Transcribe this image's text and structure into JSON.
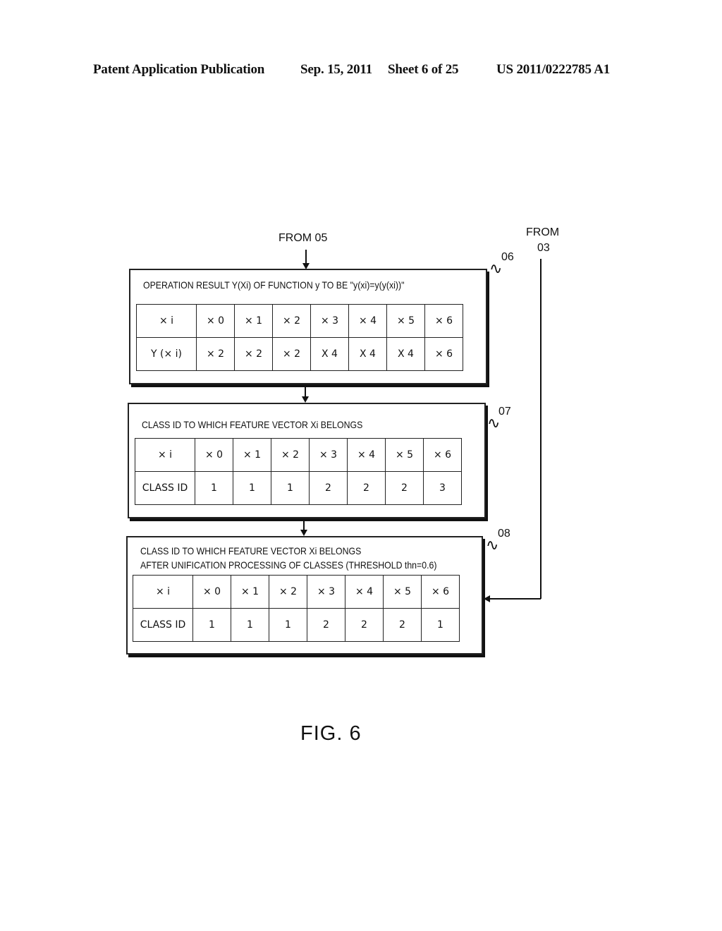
{
  "header": {
    "publication": "Patent Application Publication",
    "date": "Sep. 15, 2011",
    "sheet": "Sheet 6 of 25",
    "number": "US 2011/0222785 A1"
  },
  "connectors": {
    "from_top": "FROM 05",
    "from_right_line1": "FROM",
    "from_right_line2": "03"
  },
  "blocks": [
    {
      "ref": "06",
      "title_lines": [
        "OPERATION RESULT Y(Xi) OF FUNCTION y TO BE \"y(xi)=y(y(xi))\""
      ],
      "table": {
        "row_headers": [
          "× i",
          "Y (× i)"
        ],
        "columns": [
          "× 0",
          "× 1",
          "× 2",
          "× 3",
          "× 4",
          "× 5",
          "× 6"
        ],
        "values": [
          "× 2",
          "× 2",
          "× 2",
          "X 4",
          "X 4",
          "X 4",
          "× 6"
        ]
      }
    },
    {
      "ref": "07",
      "title_lines": [
        "CLASS ID TO WHICH FEATURE VECTOR Xi BELONGS"
      ],
      "table": {
        "row_headers": [
          "× i",
          "CLASS ID"
        ],
        "columns": [
          "× 0",
          "× 1",
          "× 2",
          "× 3",
          "× 4",
          "× 5",
          "× 6"
        ],
        "values": [
          "1",
          "1",
          "1",
          "2",
          "2",
          "2",
          "3"
        ]
      }
    },
    {
      "ref": "08",
      "title_lines": [
        "CLASS ID TO WHICH FEATURE VECTOR Xi BELONGS",
        "AFTER UNIFICATION PROCESSING OF CLASSES (THRESHOLD thn=0.6)"
      ],
      "table": {
        "row_headers": [
          "× i",
          "CLASS ID"
        ],
        "columns": [
          "× 0",
          "× 1",
          "× 2",
          "× 3",
          "× 4",
          "× 5",
          "× 6"
        ],
        "values": [
          "1",
          "1",
          "1",
          "2",
          "2",
          "2",
          "1"
        ]
      }
    }
  ],
  "figure_label": "FIG. 6"
}
